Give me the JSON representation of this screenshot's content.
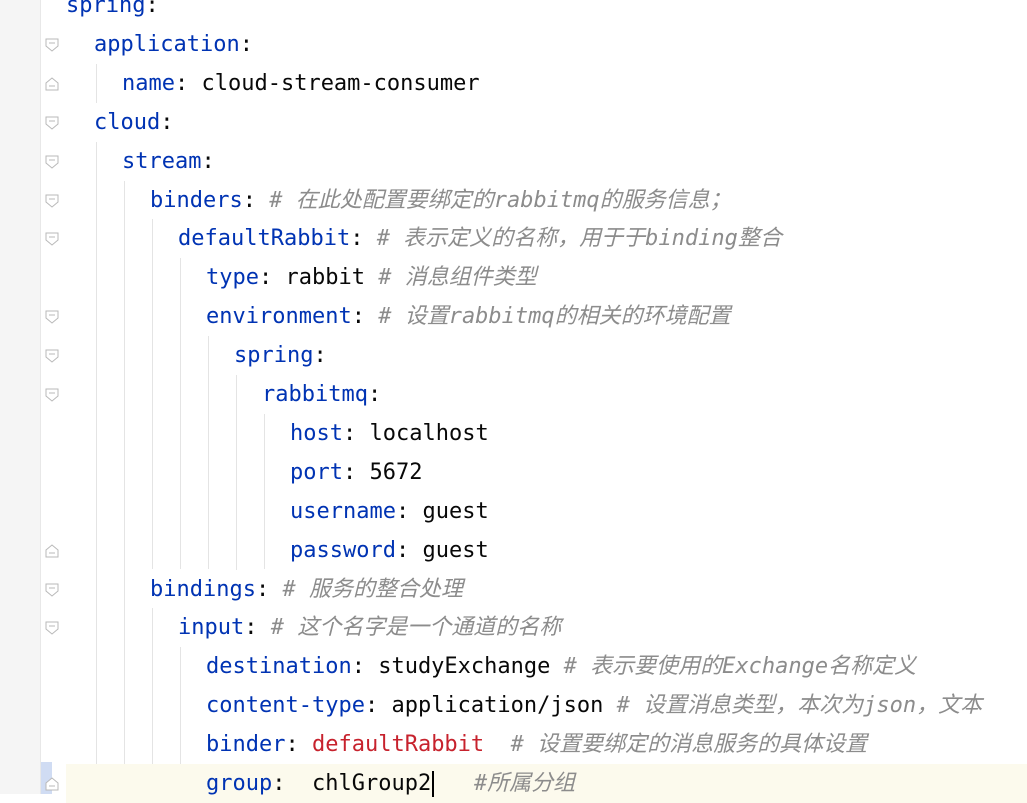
{
  "lines": [
    {
      "key": "spring",
      "sep": ":",
      "value": "",
      "comment": "",
      "value_red": false
    },
    {
      "key": "application",
      "sep": ":",
      "value": "",
      "comment": "",
      "value_red": false
    },
    {
      "key": "name",
      "sep": ": ",
      "value": "cloud-stream-consumer",
      "comment": "",
      "value_red": false
    },
    {
      "key": "cloud",
      "sep": ":",
      "value": "",
      "comment": "",
      "value_red": false
    },
    {
      "key": "stream",
      "sep": ":",
      "value": "",
      "comment": "",
      "value_red": false
    },
    {
      "key": "binders",
      "sep": ": ",
      "value": "",
      "comment": "# 在此处配置要绑定的rabbitmq的服务信息；",
      "value_red": false
    },
    {
      "key": "defaultRabbit",
      "sep": ": ",
      "value": "",
      "comment": "# 表示定义的名称，用于于binding整合",
      "value_red": false
    },
    {
      "key": "type",
      "sep": ": ",
      "value": "rabbit ",
      "comment": "# 消息组件类型",
      "value_red": false
    },
    {
      "key": "environment",
      "sep": ": ",
      "value": "",
      "comment": "# 设置rabbitmq的相关的环境配置",
      "value_red": false
    },
    {
      "key": "spring",
      "sep": ":",
      "value": "",
      "comment": "",
      "value_red": false
    },
    {
      "key": "rabbitmq",
      "sep": ":",
      "value": "",
      "comment": "",
      "value_red": false
    },
    {
      "key": "host",
      "sep": ": ",
      "value": "localhost",
      "comment": "",
      "value_red": false
    },
    {
      "key": "port",
      "sep": ": ",
      "value": "5672",
      "comment": "",
      "value_red": false
    },
    {
      "key": "username",
      "sep": ": ",
      "value": "guest",
      "comment": "",
      "value_red": false
    },
    {
      "key": "password",
      "sep": ": ",
      "value": "guest",
      "comment": "",
      "value_red": false
    },
    {
      "key": "bindings",
      "sep": ": ",
      "value": "",
      "comment": "# 服务的整合处理",
      "value_red": false
    },
    {
      "key": "input",
      "sep": ": ",
      "value": "",
      "comment": "# 这个名字是一个通道的名称",
      "value_red": false
    },
    {
      "key": "destination",
      "sep": ": ",
      "value": "studyExchange ",
      "comment": "# 表示要使用的Exchange名称定义",
      "value_red": false
    },
    {
      "key": "content-type",
      "sep": ": ",
      "value": "application/json ",
      "comment": "# 设置消息类型，本次为json，文本",
      "value_red": false
    },
    {
      "key": "binder",
      "sep": ": ",
      "value": "defaultRabbit",
      "comment": "  # 设置要绑定的消息服务的具体设置",
      "value_red": true
    },
    {
      "key": "group",
      "sep": ":  ",
      "value": "chlGroup2",
      "comment": "   #所属分组",
      "value_red": false
    }
  ],
  "colors": {
    "key": "#0033b3",
    "text": "#080808",
    "comment": "#8c8c8c",
    "red_value": "#c7222d",
    "current_line": "#fcfaed"
  }
}
